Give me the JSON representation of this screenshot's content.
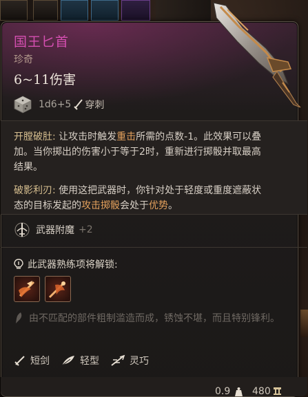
{
  "item": {
    "name": "国王匕首",
    "rarity": "珍奇",
    "damage": "6~11伤害",
    "dice": "1d6+5",
    "damage_type": "穿刺"
  },
  "passives": [
    {
      "name": "开膛破肚:",
      "text_before": " 让攻击时触发",
      "highlight": "重击",
      "text_after": "所需的点数-1。此效果可以叠加。当你掷出的伤害小于等于2时，重新进行掷骰并取最高结果。"
    },
    {
      "name": "破影利刃:",
      "text_before": " 使用这把武器时，你针对处于轻度或重度遮蔽状态的目标发起的",
      "highlight": "攻击掷骰",
      "text_mid": "会处于",
      "highlight2": "优势",
      "text_after": "。"
    }
  ],
  "enchantment": {
    "label": "武器附魔",
    "value": "+2"
  },
  "proficiency": {
    "header": "此武器熟练项将解锁:"
  },
  "lore": "由不匹配的部件粗制滥造而成，锈蚀不堪，而且特别锋利。",
  "properties": [
    {
      "icon": "short-sword-icon",
      "label": "短剑"
    },
    {
      "icon": "feather-icon",
      "label": "轻型"
    },
    {
      "icon": "finesse-icon",
      "label": "灵巧"
    }
  ],
  "footer": {
    "weight": "0.9",
    "price": "480"
  },
  "colors": {
    "title": "#d54fb1",
    "highlight": "#e3a05c",
    "passive_name": "#d7bf90"
  }
}
